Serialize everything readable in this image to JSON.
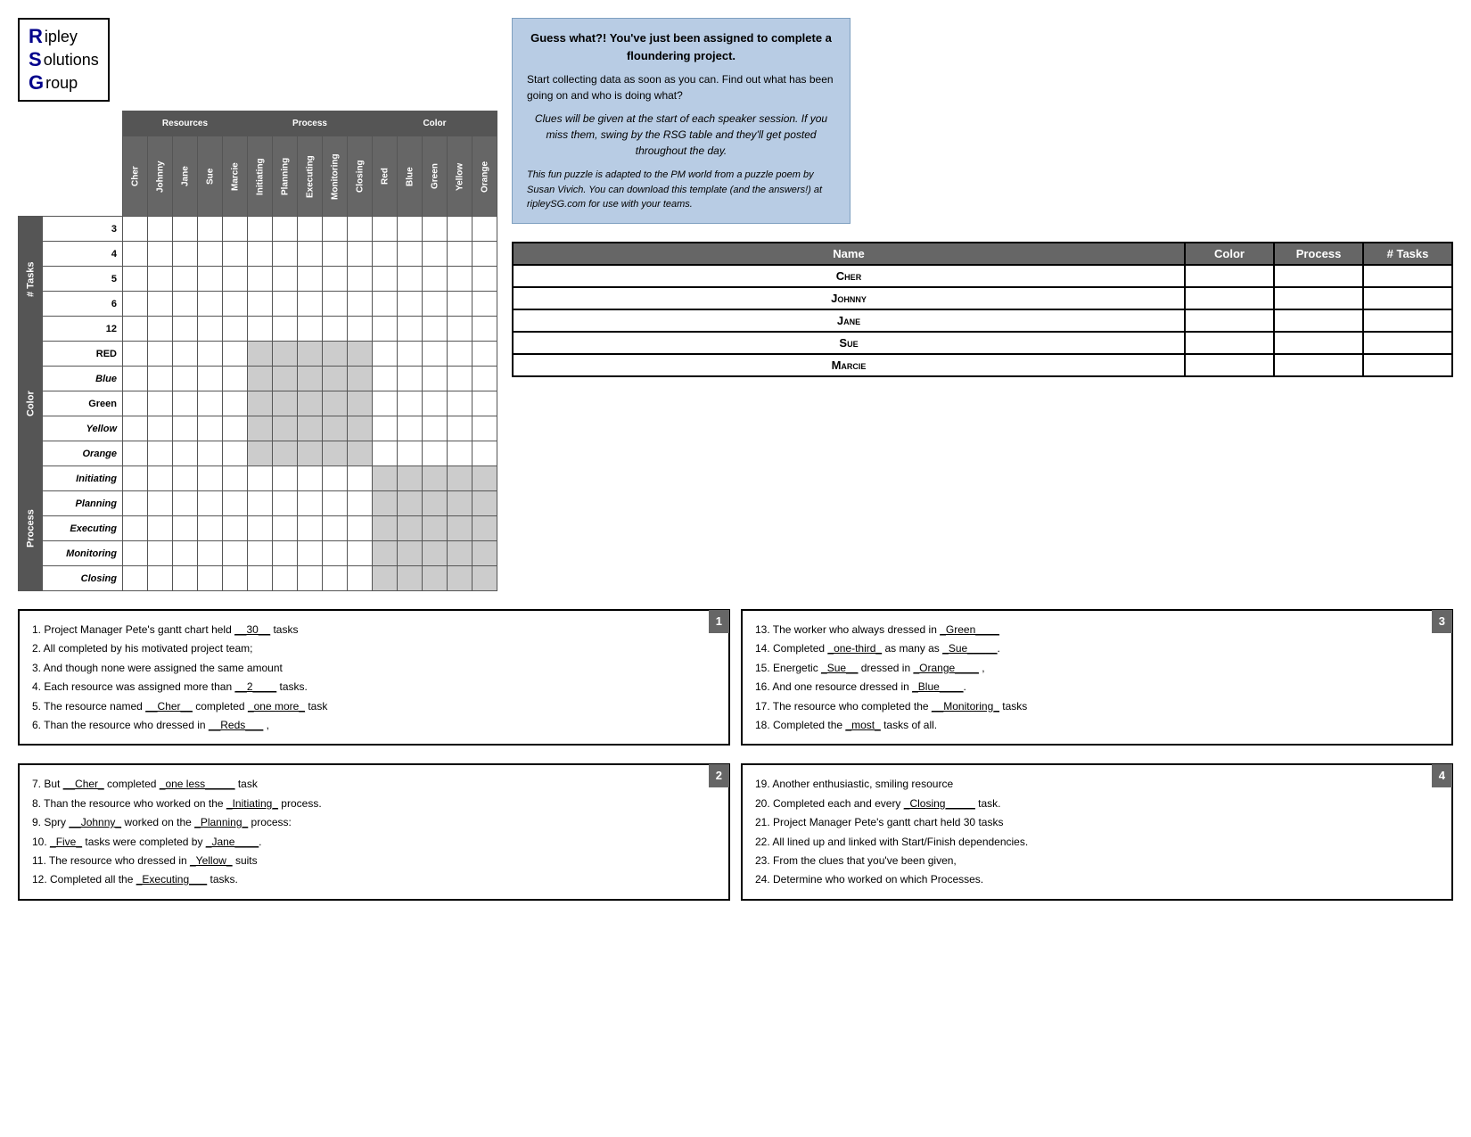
{
  "logo": {
    "line1": "ipley",
    "line2": "olutions",
    "line3": "roup"
  },
  "grid": {
    "resources_header": "Resources",
    "process_header": "Process",
    "color_header": "Color",
    "col_headers": [
      "Cher",
      "Johnny",
      "Jane",
      "Sue",
      "Marcie",
      "Initiating",
      "Planning",
      "Executing",
      "Monitoring",
      "Closing",
      "Red",
      "Blue",
      "Green",
      "Yellow",
      "Orange"
    ],
    "row_group_tasks": "# Tasks",
    "row_group_color": "Color",
    "row_group_process": "Process",
    "task_rows": [
      "3",
      "4",
      "5",
      "6",
      "12"
    ],
    "color_rows": [
      "Red",
      "Blue",
      "Green",
      "Yellow",
      "Orange"
    ],
    "process_rows": [
      "Initiating",
      "Planning",
      "Executing",
      "Monitoring",
      "Closing"
    ]
  },
  "summary_table": {
    "headers": [
      "Name",
      "Color",
      "Process",
      "# Tasks"
    ],
    "rows": [
      {
        "name": "Cher",
        "color": "",
        "process": "",
        "tasks": ""
      },
      {
        "name": "Johnny",
        "color": "",
        "process": "",
        "tasks": ""
      },
      {
        "name": "Jane",
        "color": "",
        "process": "",
        "tasks": ""
      },
      {
        "name": "Sue",
        "color": "",
        "process": "",
        "tasks": ""
      },
      {
        "name": "Marcie",
        "color": "",
        "process": "",
        "tasks": ""
      }
    ]
  },
  "info_box": {
    "title": "Guess what?! You've just been assigned to complete a floundering project.",
    "body1": "Start collecting data as soon as you can.  Find out what has been going on and who is doing what?",
    "body2": "Clues will be given at the start of each speaker session.  If you miss them, swing by the RSG table and they'll get posted throughout the day.",
    "body3": "This fun puzzle is adapted to the PM world from a puzzle poem by Susan Vivich.  You can download this template (and the answers!) at ripleySG.com for use with your teams."
  },
  "clues": {
    "box1_number": "1",
    "box1_lines": [
      "1.  Project Manager Pete's gantt chart held __30__ tasks",
      "2.  All completed by his motivated project team;",
      "3.  And though none were assigned the same amount",
      "4.  Each resource was assigned more than __2____ tasks.",
      "5.  The resource named __Cher__ completed _one more_ task",
      "6.  Than the resource who dressed in __Reds___ ,"
    ],
    "box2_number": "2",
    "box2_lines": [
      "7.  But __Cher_ completed _one less_____ task",
      "8.  Than the resource who worked on the _Initiating_ process.",
      "9.  Spry __Johnny_ worked on the _Planning_ process:",
      "10. _Five_ tasks were completed by _Jane____.",
      "11. The resource who dressed in _Yellow_ suits",
      "12. Completed all the _Executing___ tasks."
    ],
    "box3_number": "3",
    "box3_lines": [
      "13. The worker who always dressed in _Green____",
      "14. Completed _one-third_ as many as _Sue_____.",
      "15. Energetic _Sue__ dressed in _Orange____ ,",
      "16. And one resource dressed in _Blue____.",
      "17. The resource who completed the __Monitoring_ tasks",
      "18. Completed the _most_ tasks of all."
    ],
    "box4_number": "4",
    "box4_lines": [
      "19. Another enthusiastic, smiling resource",
      "20. Completed each and every _Closing____ task.",
      "21. Project Manager Pete's gantt chart held 30 tasks",
      "22. All lined up and linked with Start/Finish dependencies.",
      "23. From the clues that you've been given,",
      "24. Determine who worked on which Processes."
    ]
  }
}
